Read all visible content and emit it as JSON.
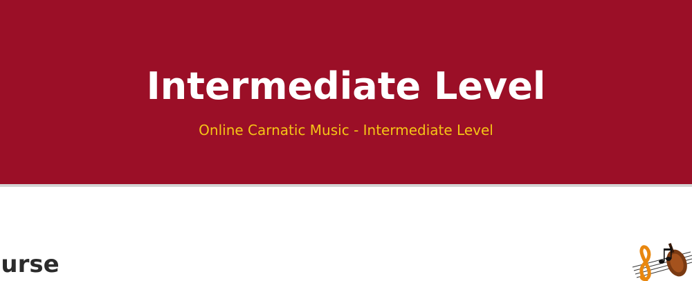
{
  "hero": {
    "title": "Intermediate Level",
    "subtitle": "Online Carnatic Music - Intermediate Level"
  },
  "content": {
    "section_heading_visible_text": "ourse"
  },
  "colors": {
    "hero_background": "#9b0f27",
    "hero_title": "#ffffff",
    "hero_subtitle": "#f5c516",
    "divider": "#d3d3d3",
    "heading_text": "#2b2b2b"
  },
  "icons": {
    "decorative_art": "music-notes-violin-icon"
  }
}
